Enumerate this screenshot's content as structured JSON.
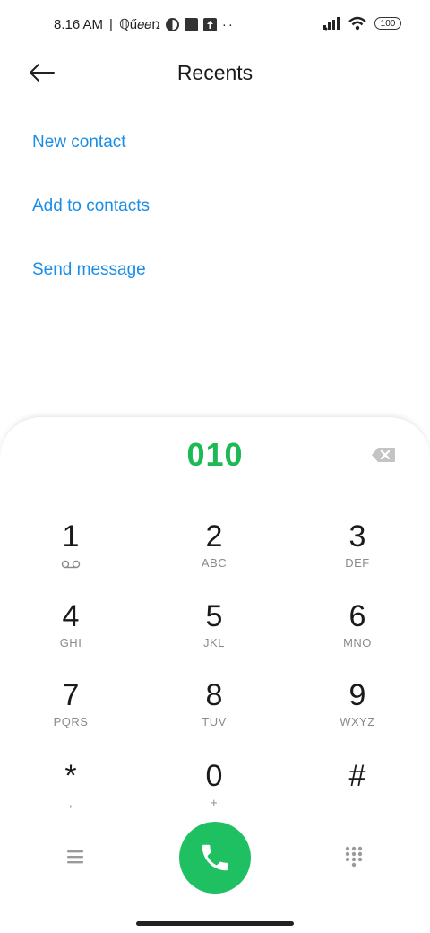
{
  "status_bar": {
    "time": "8.16 AM",
    "separator": "|",
    "app_text": "ℚű𝑒𝑒ռ",
    "more": "··",
    "battery": "100"
  },
  "header": {
    "title": "Recents"
  },
  "actions": {
    "new_contact": "New contact",
    "add_to_contacts": "Add to contacts",
    "send_message": "Send message"
  },
  "dialer": {
    "number": "010",
    "keys": [
      {
        "digit": "1",
        "sub": ""
      },
      {
        "digit": "2",
        "sub": "ABC"
      },
      {
        "digit": "3",
        "sub": "DEF"
      },
      {
        "digit": "4",
        "sub": "GHI"
      },
      {
        "digit": "5",
        "sub": "JKL"
      },
      {
        "digit": "6",
        "sub": "MNO"
      },
      {
        "digit": "7",
        "sub": "PQRS"
      },
      {
        "digit": "8",
        "sub": "TUV"
      },
      {
        "digit": "9",
        "sub": "WXYZ"
      },
      {
        "digit": "*",
        "sub": ","
      },
      {
        "digit": "0",
        "sub": "+"
      },
      {
        "digit": "#",
        "sub": ""
      }
    ]
  },
  "colors": {
    "accent_blue": "#1a8ee6",
    "number_green": "#1db954",
    "call_green": "#1fc061"
  },
  "icons": {
    "back": "arrow-left-icon",
    "backspace": "backspace-icon",
    "voicemail": "voicemail-icon",
    "menu": "menu-icon",
    "call": "phone-icon",
    "keypad": "dialpad-icon"
  }
}
